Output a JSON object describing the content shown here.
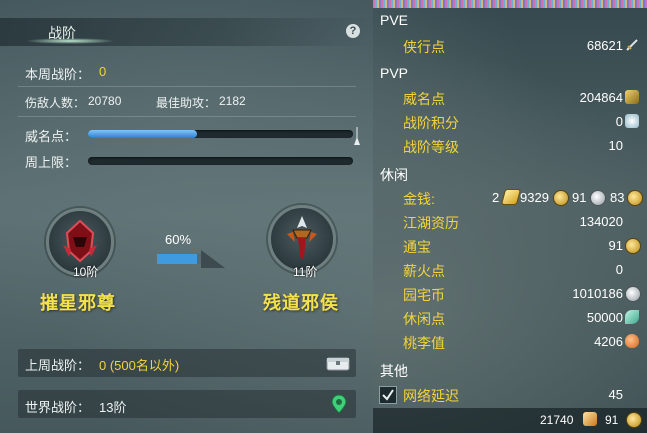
{
  "left_panel": {
    "tab_title": "战阶",
    "help_icon": "?",
    "weekly_rank_label": "本周战阶：",
    "weekly_rank_value": "0",
    "kills_label": "伤敌人数：",
    "kills_value": "20780",
    "best_assist_label": "最佳助攻：",
    "best_assist_value": "2182",
    "prestige_label": "威名点：",
    "prestige_progress": 0.41,
    "weekly_cap_label": "周上限：",
    "weekly_cap_progress": 0,
    "current_rank": {
      "level": "10阶",
      "name": "摧星邪尊"
    },
    "next_rank": {
      "level": "11阶",
      "name": "残道邪侯"
    },
    "progress_percent": "60%",
    "last_week_label": "上周战阶：",
    "last_week_value": "0 (500名以外)",
    "world_rank_label": "世界战阶：",
    "world_rank_value": "13阶"
  },
  "right_panel": {
    "pve": {
      "title": "PVE",
      "rows": [
        {
          "label": "侠行点",
          "value": "68621"
        }
      ]
    },
    "pvp": {
      "title": "PVP",
      "rows": [
        {
          "label": "威名点",
          "value": "204864"
        },
        {
          "label": "战阶积分",
          "value": "0"
        },
        {
          "label": "战阶等级",
          "value": "10"
        }
      ]
    },
    "leisure": {
      "title": "休闲",
      "money_label": "金钱:",
      "money_gold_bars": "2",
      "money_gold": "9329",
      "money_silver": "91",
      "money_copper": "83",
      "rows": [
        {
          "label": "江湖资历",
          "value": "134020"
        },
        {
          "label": "通宝",
          "value": "91"
        },
        {
          "label": "薪火点",
          "value": "0"
        },
        {
          "label": "园宅币",
          "value": "1010186"
        },
        {
          "label": "休闲点",
          "value": "50000"
        },
        {
          "label": "桃李值",
          "value": "4206"
        }
      ]
    },
    "other": {
      "title": "其他",
      "latency_label": "网络延迟",
      "latency_value": "45",
      "latency_checked": true
    },
    "bottom": {
      "value1": "21740",
      "value2": "91"
    }
  }
}
